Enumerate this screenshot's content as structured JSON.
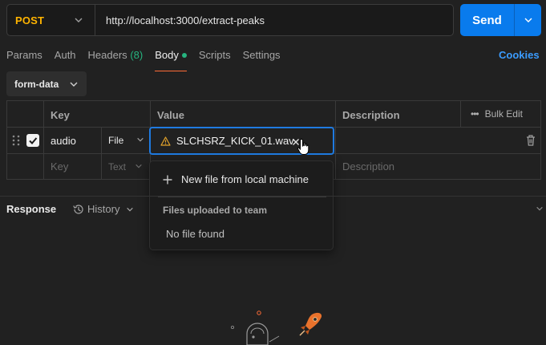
{
  "request": {
    "method": "POST",
    "url": "http://localhost:3000/extract-peaks",
    "send_label": "Send"
  },
  "tabs": [
    {
      "label": "Params"
    },
    {
      "label": "Auth"
    },
    {
      "label": "Headers",
      "count": "(8)"
    },
    {
      "label": "Body",
      "active": true
    },
    {
      "label": "Scripts"
    },
    {
      "label": "Settings"
    }
  ],
  "cookies_label": "Cookies",
  "body_type": "form-data",
  "table": {
    "headers": {
      "key": "Key",
      "value": "Value",
      "description": "Description",
      "bulk_edit": "Bulk Edit"
    },
    "rows": [
      {
        "key": "audio",
        "type": "File",
        "value": "SLCHSRZ_KICK_01.wav",
        "checked": true
      }
    ],
    "placeholder": {
      "key": "Key",
      "type": "Text",
      "description": "Description"
    }
  },
  "dropdown": {
    "new_file": "New file from local machine",
    "section": "Files uploaded to team",
    "empty": "No file found"
  },
  "response": {
    "label": "Response",
    "history": "History"
  },
  "colors": {
    "method": "#ffb400",
    "send": "#097bed",
    "active_tab_underline": "#ff6c37",
    "count": "#26b47f",
    "link": "#3b9cff",
    "warning": "#e3a32b"
  }
}
